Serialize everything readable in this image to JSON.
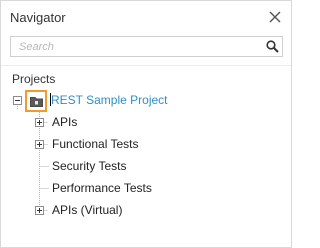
{
  "panel": {
    "title": "Navigator",
    "close_icon": "close-icon",
    "search": {
      "placeholder": "Search",
      "value": "",
      "icon": "search-icon"
    },
    "section_label": "Projects"
  },
  "tree": {
    "root": {
      "label": "REST Sample Project",
      "icon": "project-folder-icon",
      "expanded": true,
      "selected": true
    },
    "children": [
      {
        "label": "APIs",
        "expandable": true
      },
      {
        "label": "Functional Tests",
        "expandable": true
      },
      {
        "label": "Security Tests",
        "expandable": false
      },
      {
        "label": "Performance Tests",
        "expandable": false
      },
      {
        "label": "APIs (Virtual)",
        "expandable": true
      }
    ]
  },
  "colors": {
    "selection_outline": "#f39b2a",
    "project_link": "#2f8fc4",
    "tree_line": "#b0b0b0"
  }
}
